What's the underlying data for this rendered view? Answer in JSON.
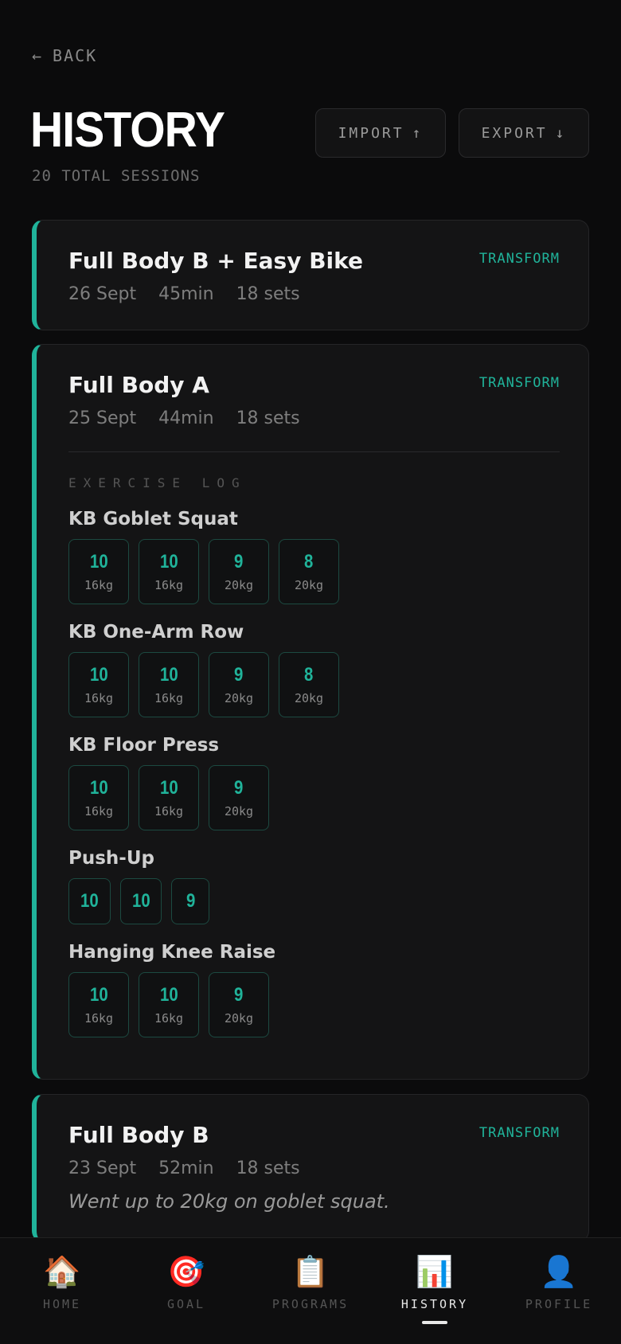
{
  "header": {
    "back_arrow": "←",
    "back_label": "BACK",
    "title": "HISTORY",
    "subtitle": "20 TOTAL SESSIONS",
    "import_label": "IMPORT",
    "import_icon": "↑",
    "export_label": "EXPORT",
    "export_icon": "↓"
  },
  "colors": {
    "accent": "#20b39a",
    "background": "#0b0b0c",
    "card": "#141415"
  },
  "sessions": [
    {
      "title": "Full Body B + Easy Bike",
      "date": "26 Sept",
      "duration": "45min",
      "sets": "18 sets",
      "tag": "TRANSFORM"
    },
    {
      "title": "Full Body A",
      "date": "25 Sept",
      "duration": "44min",
      "sets": "18 sets",
      "tag": "TRANSFORM",
      "log_label": "EXERCISE LOG",
      "exercises": [
        {
          "name": "KB Goblet Squat",
          "sets": [
            {
              "reps": "10",
              "weight": "16kg"
            },
            {
              "reps": "10",
              "weight": "16kg"
            },
            {
              "reps": "9",
              "weight": "20kg"
            },
            {
              "reps": "8",
              "weight": "20kg"
            }
          ]
        },
        {
          "name": "KB One-Arm Row",
          "sets": [
            {
              "reps": "10",
              "weight": "16kg"
            },
            {
              "reps": "10",
              "weight": "16kg"
            },
            {
              "reps": "9",
              "weight": "20kg"
            },
            {
              "reps": "8",
              "weight": "20kg"
            }
          ]
        },
        {
          "name": "KB Floor Press",
          "sets": [
            {
              "reps": "10",
              "weight": "16kg"
            },
            {
              "reps": "10",
              "weight": "16kg"
            },
            {
              "reps": "9",
              "weight": "20kg"
            }
          ]
        },
        {
          "name": "Push-Up",
          "sets": [
            {
              "reps": "10"
            },
            {
              "reps": "10"
            },
            {
              "reps": "9"
            }
          ]
        },
        {
          "name": "Hanging Knee Raise",
          "sets": [
            {
              "reps": "10",
              "weight": "16kg"
            },
            {
              "reps": "10",
              "weight": "16kg"
            },
            {
              "reps": "9",
              "weight": "20kg"
            }
          ]
        }
      ]
    },
    {
      "title": "Full Body B",
      "date": "23 Sept",
      "duration": "52min",
      "sets": "18 sets",
      "tag": "TRANSFORM",
      "note": "Went up to 20kg on goblet squat."
    }
  ],
  "nav": [
    {
      "icon": "🏠",
      "icon_name": "home-icon",
      "label": "HOME"
    },
    {
      "icon": "🎯",
      "icon_name": "goal-icon",
      "label": "GOAL"
    },
    {
      "icon": "📋",
      "icon_name": "clipboard-icon",
      "label": "PROGRAMS"
    },
    {
      "icon": "📊",
      "icon_name": "chart-icon",
      "label": "HISTORY",
      "active": true
    },
    {
      "icon": "👤",
      "icon_name": "profile-icon",
      "label": "PROFILE"
    }
  ]
}
